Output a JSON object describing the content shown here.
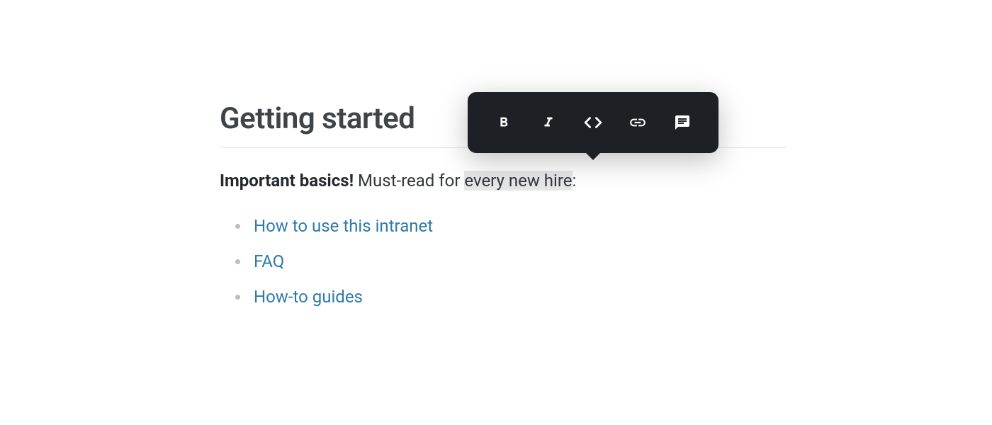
{
  "page": {
    "title": "Getting started"
  },
  "intro": {
    "bold_text": "Important basics!",
    "text_before_selection": " Must-read for ",
    "selected_text": "every new hire",
    "text_after_selection": ":"
  },
  "links": {
    "items": [
      {
        "label": "How to use this intranet"
      },
      {
        "label": "FAQ"
      },
      {
        "label": "How-to guides"
      }
    ]
  },
  "toolbar": {
    "buttons": [
      {
        "name": "bold"
      },
      {
        "name": "italic"
      },
      {
        "name": "code"
      },
      {
        "name": "link"
      },
      {
        "name": "comment"
      }
    ]
  }
}
